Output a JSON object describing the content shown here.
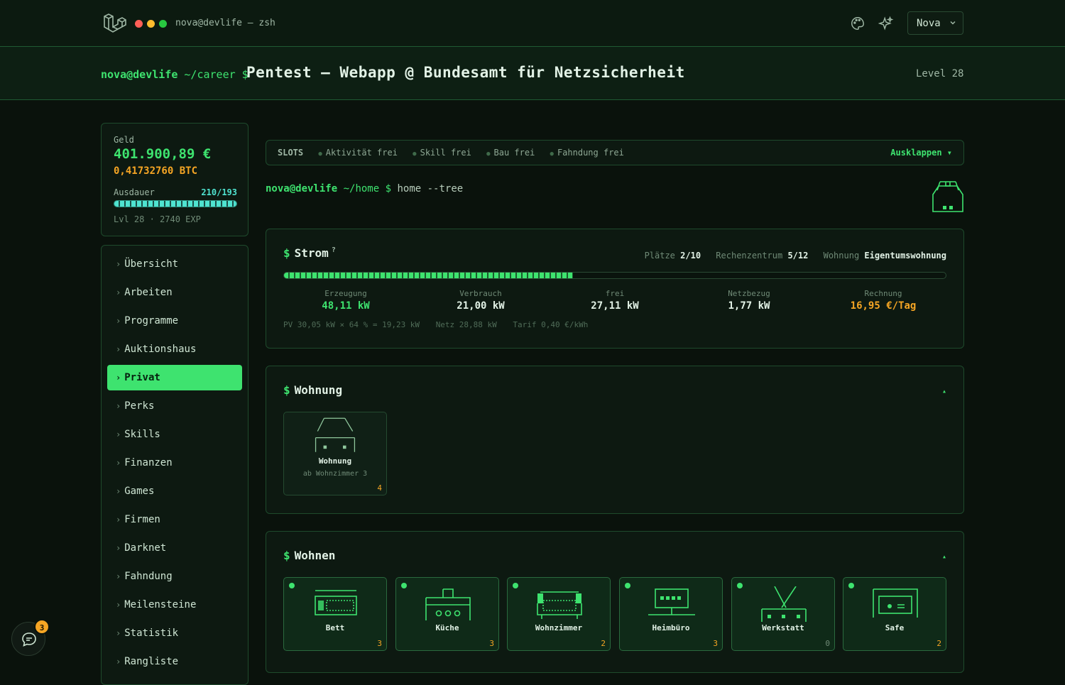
{
  "window": {
    "title": "nova@devlife — zsh",
    "user": "Nova"
  },
  "header": {
    "prompt_user": "nova@devlife",
    "prompt_path": "~/career $",
    "title": "Pentest – Webapp @ Bundesamt für Netzsicherheit",
    "level": "Level 28"
  },
  "stats": {
    "money_label": "Geld",
    "money": "401.900,89 €",
    "btc": "0,41732760 BTC",
    "stamina_label": "Ausdauer",
    "stamina_value": "210/193",
    "stamina_fill": 1.0,
    "level_line": "Lvl 28 · 2740 EXP"
  },
  "nav": {
    "items": [
      {
        "label": "Übersicht"
      },
      {
        "label": "Arbeiten"
      },
      {
        "label": "Programme"
      },
      {
        "label": "Auktionshaus"
      },
      {
        "label": "Privat"
      },
      {
        "label": "Perks"
      },
      {
        "label": "Skills"
      },
      {
        "label": "Finanzen"
      },
      {
        "label": "Games"
      },
      {
        "label": "Firmen"
      },
      {
        "label": "Darknet"
      },
      {
        "label": "Fahndung"
      },
      {
        "label": "Meilensteine"
      },
      {
        "label": "Statistik"
      },
      {
        "label": "Rangliste"
      }
    ],
    "active": "Privat"
  },
  "slots": {
    "label": "SLOTS",
    "items": [
      "Aktivität frei",
      "Skill frei",
      "Bau frei",
      "Fahndung frei"
    ],
    "expand": "Ausklappen ▾"
  },
  "command": {
    "user": "nova@devlife",
    "path": "~/home $",
    "cmd": "home --tree"
  },
  "strom": {
    "title": "Strom",
    "help": "?",
    "plaetze_label": "Plätze",
    "plaetze": "2/10",
    "rz_label": "Rechenzentrum",
    "rz": "5/12",
    "wohnung_label": "Wohnung",
    "wohnung": "Eigentumswohnung",
    "usage_fraction": 0.437,
    "kpis": [
      {
        "label": "Erzeugung",
        "value": "48,11 kW",
        "color": "#3ee36f"
      },
      {
        "label": "Verbrauch",
        "value": "21,00 kW",
        "color": "#e2f2e6"
      },
      {
        "label": "frei",
        "value": "27,11 kW",
        "color": "#e2f2e6"
      },
      {
        "label": "Netzbezug",
        "value": "1,77 kW",
        "color": "#e2f2e6"
      },
      {
        "label": "Rechnung",
        "value": "16,95 €/Tag",
        "color": "#f5a524"
      }
    ],
    "note_pv": "PV 30,05 kW × 64 % = 19,23 kW",
    "note_netz": "Netz 28,88 kW",
    "note_tarif": "Tarif 0,40 €/kWh"
  },
  "wohnung": {
    "title": "Wohnung",
    "collapse": "▴",
    "tile": {
      "name": "Wohnung",
      "sub": "ab Wohnzimmer 3",
      "count": "4"
    }
  },
  "wohnen": {
    "title": "Wohnen",
    "collapse": "▴",
    "rooms": [
      {
        "name": "Bett",
        "count": "3",
        "icon": "bed-icon"
      },
      {
        "name": "Küche",
        "count": "3",
        "icon": "stove-icon"
      },
      {
        "name": "Wohnzimmer",
        "count": "2",
        "icon": "sofa-icon"
      },
      {
        "name": "Heimbüro",
        "count": "3",
        "icon": "desk-icon"
      },
      {
        "name": "Werkstatt",
        "count": "0",
        "icon": "workbench-icon"
      },
      {
        "name": "Safe",
        "count": "2",
        "icon": "safe-icon"
      }
    ]
  },
  "chat": {
    "badge": "3"
  }
}
